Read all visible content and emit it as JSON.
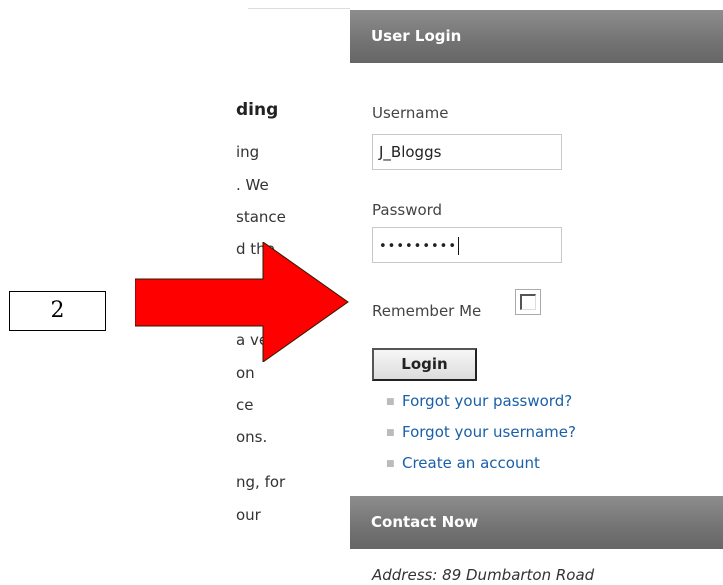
{
  "article": {
    "fragments": [
      "ding",
      "ing",
      ". We",
      "stance",
      "d the",
      "a very",
      "on",
      "ce",
      "ons.",
      "ng, for",
      "our"
    ]
  },
  "login_module": {
    "title": "User Login",
    "username_label": "Username",
    "username_value": "J_Bloggs",
    "password_label": "Password",
    "password_mask": "•••••••••",
    "remember_label": "Remember Me",
    "remember_checked": false,
    "login_button": "Login",
    "links": [
      "Forgot your password?",
      "Forgot your username?",
      "Create an account"
    ]
  },
  "contact_module": {
    "title": "Contact Now",
    "address": "Address: 89 Dumbarton Road"
  },
  "annotation": {
    "step_number": "2",
    "arrow_color": "#ff0000"
  }
}
